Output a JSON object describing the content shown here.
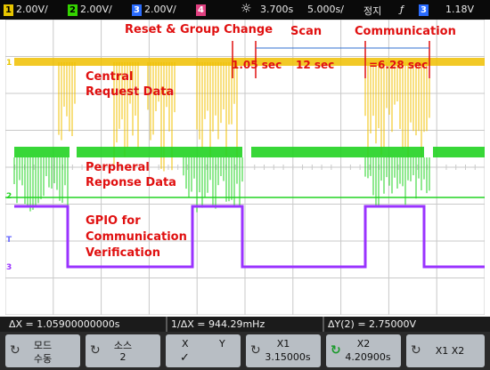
{
  "topbar": {
    "ch1_num": "1",
    "ch1_scale": "2.00V/",
    "ch2_num": "2",
    "ch2_scale": "2.00V/",
    "ch3_num": "3",
    "ch3_scale": "2.00V/",
    "ch4_num": "4",
    "time_pos": "3.700s",
    "time_scale": "5.000s/",
    "run_state": "정지",
    "trigger_icon": "rising-edge-icon",
    "trig_src_num": "3",
    "trig_level": "1.18V",
    "colors": {
      "ch1": "#e8c600",
      "ch2": "#34d400",
      "ch3": "#2a6cff",
      "ch4": "#e04080"
    }
  },
  "annotations": {
    "reset_group": "Reset & Group Change",
    "scan": "Scan",
    "communication": "Communication",
    "t_reset": "1.05 sec",
    "t_scan": "12 sec",
    "t_comm": "=6.28 sec",
    "central_1": "Central",
    "central_2": "Request Data",
    "peripheral_1": "Perpheral",
    "peripheral_2": "Reponse Data",
    "gpio_1": "GPIO for",
    "gpio_2": "Communication",
    "gpio_3": "Verification"
  },
  "markers": {
    "ch1": "1",
    "ch2": "2",
    "trig": "T",
    "ch3": "3"
  },
  "readout": {
    "delta_x": "ΔX = 1.05900000000s",
    "inv_delta_x": "1/ΔX = 944.29mHz",
    "delta_y": "ΔY(2) = 2.75000V"
  },
  "softkeys": {
    "mode_l1": "모드",
    "mode_l2": "수동",
    "source_l1": "소스",
    "source_l2": "2",
    "xy_x": "X",
    "xy_y": "Y",
    "xy_check": "✓",
    "x1_label": "X1",
    "x1_value": "3.15000s",
    "x2_label": "X2",
    "x2_value": "4.20900s",
    "x1x2_label": "X1 X2"
  },
  "colors": {
    "central_trace": "#f0c000",
    "peripheral_trace": "#22d322",
    "gpio_trace": "#9a33ff",
    "annotation": "#e01010",
    "grid": "#c9c9c9"
  }
}
